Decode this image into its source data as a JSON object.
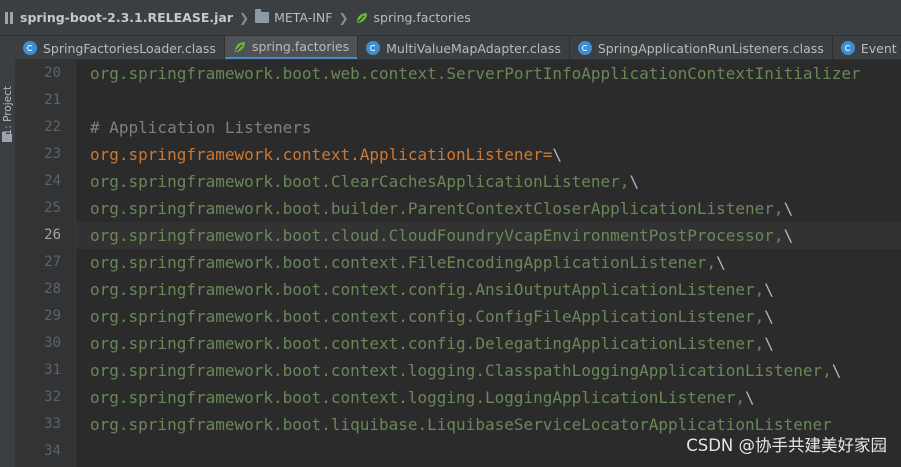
{
  "breadcrumb": {
    "jar": "spring-boot-2.3.1.RELEASE.jar",
    "folder": "META-INF",
    "file": "spring.factories"
  },
  "sidebar": {
    "label": "1: Project"
  },
  "tabs": [
    {
      "label": "SpringFactoriesLoader.class",
      "icon": "class-icon"
    },
    {
      "label": "spring.factories",
      "icon": "spring-leaf-icon",
      "active": true
    },
    {
      "label": "MultiValueMapAdapter.class",
      "icon": "class-icon"
    },
    {
      "label": "SpringApplicationRunListeners.class",
      "icon": "class-icon"
    },
    {
      "label": "Event",
      "icon": "class-icon"
    }
  ],
  "editor": {
    "current_line": "26",
    "lines": [
      {
        "num": "20",
        "text": "org.springframework.boot.web.context.ServerPortInfoApplicationContextInitializer",
        "kind": "value"
      },
      {
        "num": "21",
        "text": "",
        "kind": "value"
      },
      {
        "num": "22",
        "text": "# Application Listeners",
        "kind": "comment"
      },
      {
        "num": "23",
        "text": "org.springframework.context.ApplicationListener=",
        "kind": "key",
        "suffix": "\\"
      },
      {
        "num": "24",
        "text": "org.springframework.boot.ClearCachesApplicationListener,",
        "kind": "value",
        "suffix": "\\"
      },
      {
        "num": "25",
        "text": "org.springframework.boot.builder.ParentContextCloserApplicationListener,",
        "kind": "value",
        "suffix": "\\"
      },
      {
        "num": "26",
        "text": "org.springframework.boot.cloud.CloudFoundryVcapEnvironmentPostProcessor,",
        "kind": "value",
        "suffix": "\\"
      },
      {
        "num": "27",
        "text": "org.springframework.boot.context.FileEncodingApplicationListener,",
        "kind": "value",
        "suffix": "\\"
      },
      {
        "num": "28",
        "text": "org.springframework.boot.context.config.AnsiOutputApplicationListener,",
        "kind": "value",
        "suffix": "\\"
      },
      {
        "num": "29",
        "text": "org.springframework.boot.context.config.ConfigFileApplicationListener,",
        "kind": "value",
        "suffix": "\\"
      },
      {
        "num": "30",
        "text": "org.springframework.boot.context.config.DelegatingApplicationListener,",
        "kind": "value",
        "suffix": "\\"
      },
      {
        "num": "31",
        "text": "org.springframework.boot.context.logging.ClasspathLoggingApplicationListener,",
        "kind": "value",
        "suffix": "\\"
      },
      {
        "num": "32",
        "text": "org.springframework.boot.context.logging.LoggingApplicationListener,",
        "kind": "value",
        "suffix": "\\"
      },
      {
        "num": "33",
        "text": "org.springframework.boot.liquibase.LiquibaseServiceLocatorApplicationListener",
        "kind": "value"
      },
      {
        "num": "34",
        "text": "",
        "kind": "value"
      }
    ]
  },
  "watermark": "CSDN @协手共建美好家园",
  "colors": {
    "background": "#2b2b2b",
    "value": "#6a8759",
    "key": "#cc7832",
    "comment": "#808080",
    "active_tab_underline": "#4a88c7"
  }
}
